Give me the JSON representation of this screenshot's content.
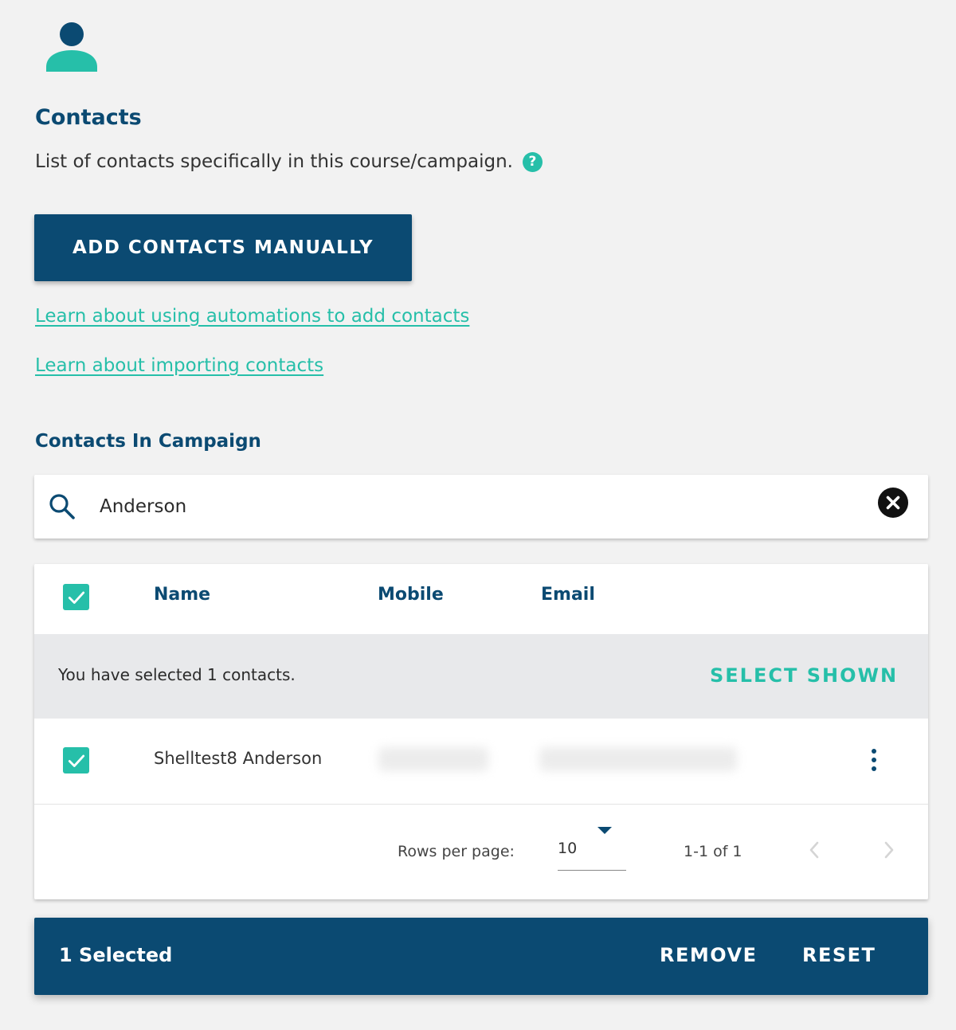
{
  "header": {
    "title": "Contacts",
    "description": "List of contacts specifically in this course/campaign.",
    "help_glyph": "?"
  },
  "actions": {
    "add_contacts_label": "ADD CONTACTS MANUALLY",
    "link_automations": "Learn about using automations to add contacts",
    "link_importing": "Learn about importing contacts"
  },
  "section_title": "Contacts In Campaign",
  "search": {
    "value": "Anderson",
    "icon": "search-icon",
    "clear_icon": "close-icon"
  },
  "table": {
    "columns": [
      "Name",
      "Mobile",
      "Email"
    ],
    "selection_banner": "You have selected 1 contacts.",
    "select_shown_label": "SELECT SHOWN",
    "rows": [
      {
        "name": "Shelltest8 Anderson",
        "checked": true
      }
    ],
    "pagination": {
      "rows_per_page_label": "Rows per page:",
      "rows_per_page_value": "10",
      "range_text": "1-1 of 1"
    }
  },
  "bottom_bar": {
    "selected_text": "1 Selected",
    "remove_label": "REMOVE",
    "reset_label": "RESET"
  },
  "colors": {
    "primary": "#0b4a72",
    "accent": "#26bfa9",
    "background": "#f2f2f2"
  }
}
